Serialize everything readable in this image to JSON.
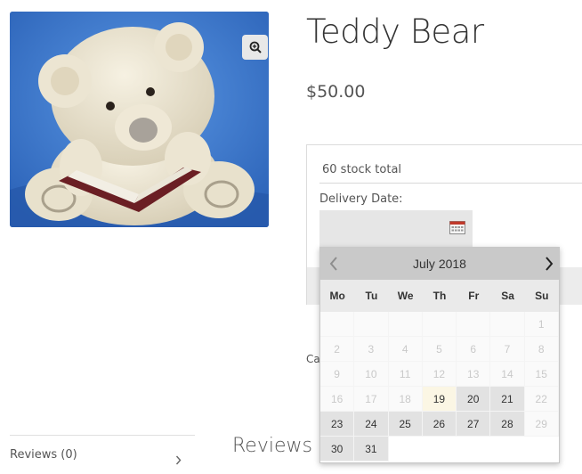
{
  "product": {
    "title": "Teddy Bear",
    "price": "$50.00",
    "image_alt": "Teddy bear reading a book"
  },
  "options": {
    "stock_text": "60 stock total",
    "delivery_label": "Delivery Date:",
    "date_value": "",
    "calendar_icon": "calendar-icon",
    "category_text": "Cat"
  },
  "datepicker": {
    "month_label": "July 2018",
    "weekdays": [
      "Mo",
      "Tu",
      "We",
      "Th",
      "Fr",
      "Sa",
      "Su"
    ],
    "weeks": [
      [
        {
          "d": "",
          "s": "empty"
        },
        {
          "d": "",
          "s": "empty"
        },
        {
          "d": "",
          "s": "empty"
        },
        {
          "d": "",
          "s": "empty"
        },
        {
          "d": "",
          "s": "empty"
        },
        {
          "d": "",
          "s": "empty"
        },
        {
          "d": "1",
          "s": "disabled"
        }
      ],
      [
        {
          "d": "2",
          "s": "disabled"
        },
        {
          "d": "3",
          "s": "disabled"
        },
        {
          "d": "4",
          "s": "disabled"
        },
        {
          "d": "5",
          "s": "disabled"
        },
        {
          "d": "6",
          "s": "disabled"
        },
        {
          "d": "7",
          "s": "disabled"
        },
        {
          "d": "8",
          "s": "disabled"
        }
      ],
      [
        {
          "d": "9",
          "s": "disabled"
        },
        {
          "d": "10",
          "s": "disabled"
        },
        {
          "d": "11",
          "s": "disabled"
        },
        {
          "d": "12",
          "s": "disabled"
        },
        {
          "d": "13",
          "s": "disabled"
        },
        {
          "d": "14",
          "s": "disabled"
        },
        {
          "d": "15",
          "s": "disabled"
        }
      ],
      [
        {
          "d": "16",
          "s": "disabled"
        },
        {
          "d": "17",
          "s": "disabled"
        },
        {
          "d": "18",
          "s": "disabled"
        },
        {
          "d": "19",
          "s": "today"
        },
        {
          "d": "20",
          "s": "active"
        },
        {
          "d": "21",
          "s": "active"
        },
        {
          "d": "22",
          "s": "disabled"
        }
      ],
      [
        {
          "d": "23",
          "s": "active"
        },
        {
          "d": "24",
          "s": "active"
        },
        {
          "d": "25",
          "s": "active"
        },
        {
          "d": "26",
          "s": "active"
        },
        {
          "d": "27",
          "s": "active"
        },
        {
          "d": "28",
          "s": "active"
        },
        {
          "d": "29",
          "s": "disabled"
        }
      ],
      [
        {
          "d": "30",
          "s": "active"
        },
        {
          "d": "31",
          "s": "active"
        },
        {
          "d": "",
          "s": "blank"
        },
        {
          "d": "",
          "s": "blank"
        },
        {
          "d": "",
          "s": "blank"
        },
        {
          "d": "",
          "s": "blank"
        },
        {
          "d": "",
          "s": "blank"
        }
      ]
    ]
  },
  "tabs": {
    "reviews_tab_label": "Reviews (0)",
    "reviews_heading": "Reviews"
  },
  "colors": {
    "image_bg": "#3d7fd6",
    "header_bg": "#c9c9c9",
    "today_bg": "#fbf6e4"
  }
}
